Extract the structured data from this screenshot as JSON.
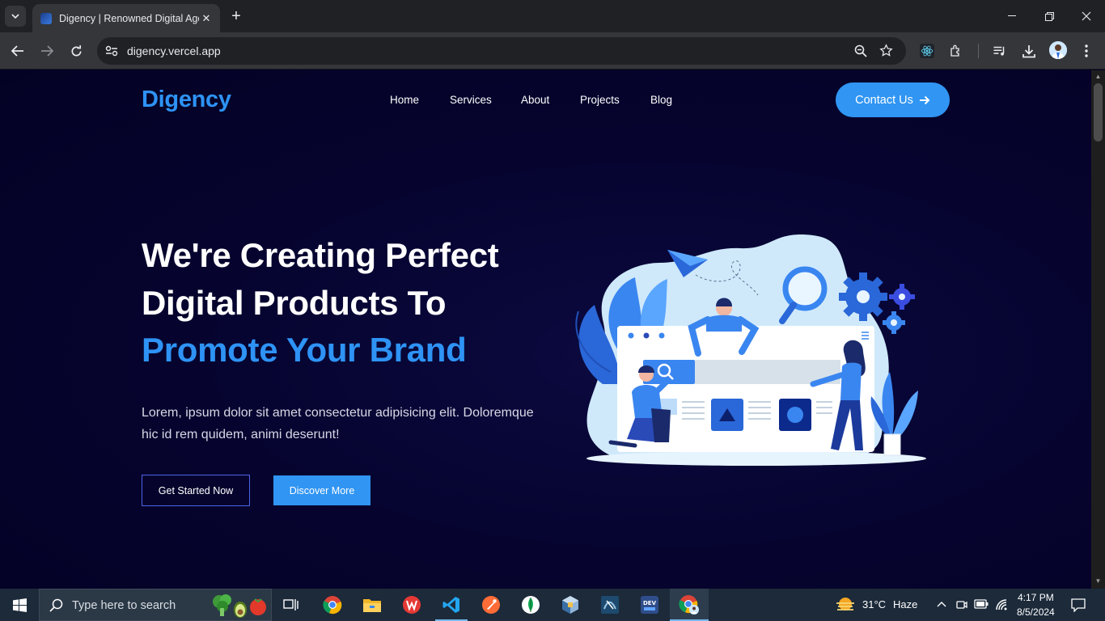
{
  "browser": {
    "tab_title": "Digency | Renowned Digital Agency",
    "url": "digency.vercel.app",
    "new_tab_label": "+",
    "close_tab_label": "✕"
  },
  "site": {
    "logo": "Digency",
    "nav": [
      "Home",
      "Services",
      "About",
      "Projects",
      "Blog"
    ],
    "contact_label": "Contact Us",
    "hero": {
      "line1": "We're Creating Perfect",
      "line2": "Digital Products To",
      "line3": "Promote Your Brand",
      "description": "Lorem, ipsum dolor sit amet consectetur adipisicing elit. Doloremque hic id rem quidem, animi deserunt!",
      "primary_button": "Get Started Now",
      "secondary_button": "Discover More"
    },
    "colors": {
      "accent": "#3095f3",
      "background": "#050327",
      "text": "#ffffff"
    }
  },
  "taskbar": {
    "search_placeholder": "Type here to search",
    "apps": [
      "task-view-icon",
      "chrome-icon",
      "file-explorer-icon",
      "wps-office-icon",
      "vscode-icon",
      "postman-icon",
      "mongodb-icon",
      "virtualbox-icon",
      "mysql-workbench-icon",
      "dev-icon",
      "chrome-profile-icon"
    ],
    "weather": {
      "temperature": "31°C",
      "condition": "Haze"
    },
    "clock": {
      "time": "4:17 PM",
      "date": "8/5/2024"
    }
  }
}
